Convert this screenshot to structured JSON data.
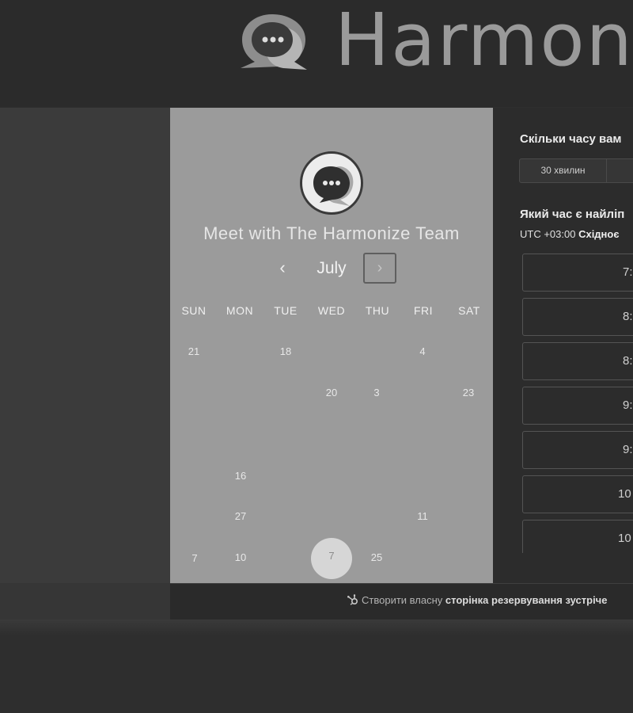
{
  "brand": {
    "name": "Harmonize"
  },
  "calendar": {
    "title": "Meet with The Harmonize Team",
    "month": "July",
    "prev_icon": "‹",
    "next_icon": "›",
    "weekdays": [
      "SUN",
      "MON",
      "TUE",
      "WED",
      "THU",
      "FRI",
      "SAT"
    ],
    "days": [
      "21",
      "18",
      "4",
      "20",
      "3",
      "23",
      "16",
      "27",
      "11",
      "7",
      "10",
      "25"
    ],
    "selected_day": "7"
  },
  "booking": {
    "duration_question": "Скільки часу вам",
    "duration_option": "30 хвилин",
    "time_question": "Який час є найліп",
    "timezone_prefix": "UTC +03:00",
    "timezone_name": "Східноє",
    "slots": [
      "7:",
      "8:",
      "8:",
      "9:",
      "9:",
      "10",
      "10"
    ]
  },
  "footer": {
    "prefix": "Створити власну",
    "bold": "сторінка резервування зустріче"
  },
  "colors": {
    "page_bg": "#2e2e2e",
    "calendar_bg": "#9b9b9b",
    "panel_bg": "#2c2c2c"
  },
  "icons": {
    "logo": "chat-bubble-logo-icon",
    "prev": "chevron-left-icon",
    "next": "chevron-right-icon",
    "footer": "hubspot-sprocket-icon"
  }
}
